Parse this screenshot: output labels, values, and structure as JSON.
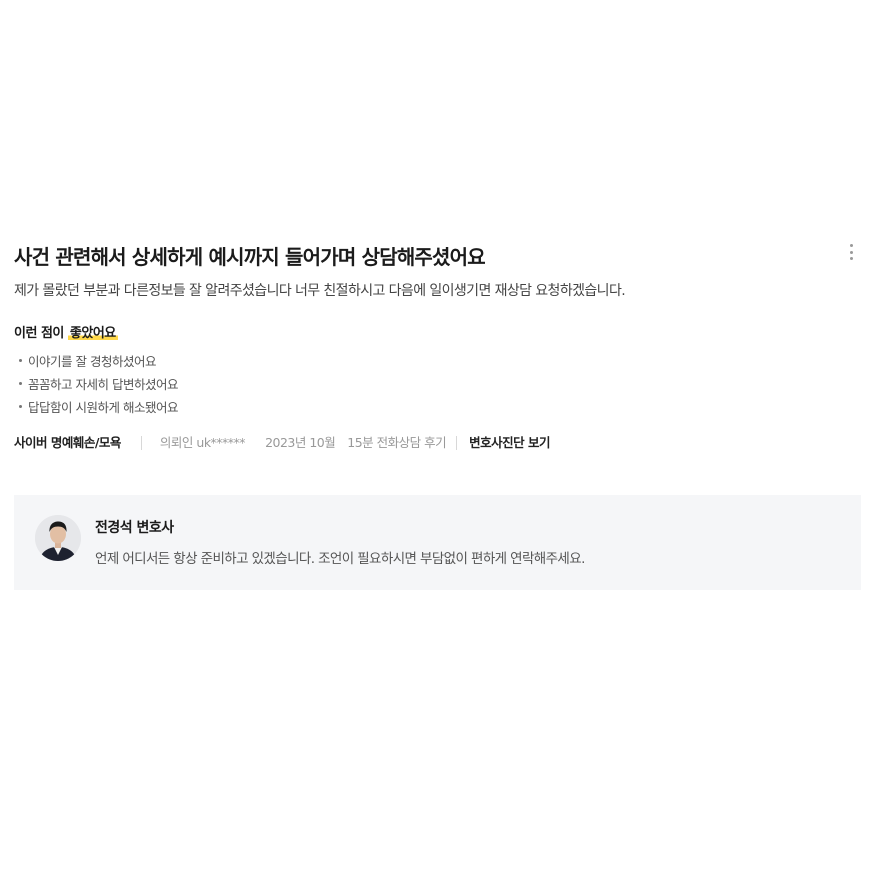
{
  "review": {
    "title": "사건 관련해서 상세하게 예시까지 들어가며 상담해주셨어요",
    "body": "제가 몰랐던 부분과 다른정보들 잘 알려주셨습니다 너무 친절하시고 다음에 일이생기면 재상담 요청하겠습니다.",
    "good_points_prefix": "이런 점이 ",
    "good_points_highlight": "좋았어요",
    "points": [
      "이야기를 잘 경청하셨어요",
      "꼼꼼하고 자세히 답변하셨어요",
      "답답함이 시원하게 해소됐어요"
    ],
    "meta": {
      "category": "사이버 명예훼손/모욕",
      "client": "의뢰인 uk******",
      "date": "2023년 10월",
      "consult_type": "15분 전화상담 후기",
      "diagnosis_link": "변호사진단 보기"
    },
    "more_icon": "more-vertical-icon",
    "highlight_color": "#ffd84a"
  },
  "reply": {
    "lawyer_name": "전경석 변호사",
    "text": "언제 어디서든 항상 준비하고 있겠습니다. 조언이 필요하시면 부담없이 편하게 연락해주세요.",
    "background_color": "#f5f6f8"
  }
}
